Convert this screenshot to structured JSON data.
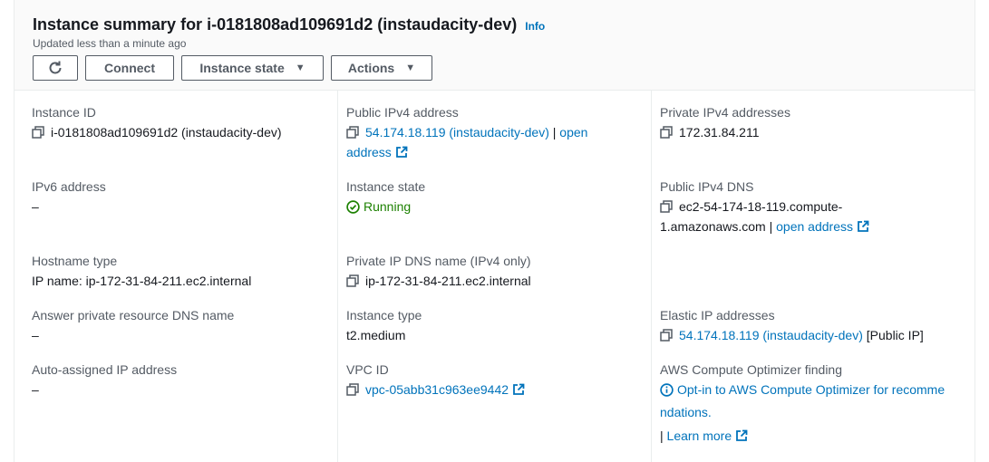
{
  "header": {
    "title": "Instance summary for i-0181808ad109691d2 (instaudacity-dev)",
    "info": "Info",
    "updated": "Updated less than a minute ago",
    "buttons": {
      "connect": "Connect",
      "instance_state": "Instance state",
      "actions": "Actions"
    }
  },
  "fields": {
    "instance_id": {
      "label": "Instance ID",
      "value": "i-0181808ad109691d2 (instaudacity-dev)"
    },
    "public_ipv4": {
      "label": "Public IPv4 address",
      "value": "54.174.18.119 (instaudacity-dev)",
      "sep": "|",
      "open1": "open",
      "open2": "address"
    },
    "private_ipv4": {
      "label": "Private IPv4 addresses",
      "value": "172.31.84.211"
    },
    "ipv6": {
      "label": "IPv6 address",
      "value": "–"
    },
    "instance_state": {
      "label": "Instance state",
      "value": "Running"
    },
    "public_dns": {
      "label": "Public IPv4 DNS",
      "line1": "ec2-54-174-18-119.compute-",
      "line2": "1.amazonaws.com",
      "sep": "|",
      "open": "open address"
    },
    "hostname_type": {
      "label": "Hostname type",
      "value": "IP name: ip-172-31-84-211.ec2.internal"
    },
    "private_dns": {
      "label": "Private IP DNS name (IPv4 only)",
      "value": "ip-172-31-84-211.ec2.internal"
    },
    "answer_dns": {
      "label": "Answer private resource DNS name",
      "value": "–"
    },
    "instance_type": {
      "label": "Instance type",
      "value": "t2.medium"
    },
    "elastic_ip": {
      "label": "Elastic IP addresses",
      "value": "54.174.18.119 (instaudacity-dev)",
      "suffix": "[Public IP]"
    },
    "auto_ip": {
      "label": "Auto-assigned IP address",
      "value": "–"
    },
    "vpc": {
      "label": "VPC ID",
      "value": "vpc-05abb31c963ee9442"
    },
    "optimizer": {
      "label": "AWS Compute Optimizer finding",
      "line1": "Opt-in to AWS Compute Optimizer for recomme",
      "line2": "ndations.",
      "sep": "|",
      "learn": "Learn more"
    }
  },
  "colors": {
    "link": "#0073bb",
    "success": "#1d8102",
    "text": "#16191f",
    "label": "#545b64"
  },
  "icons": [
    "refresh-icon",
    "caret-down-icon",
    "copy-icon",
    "external-link-icon",
    "check-circle-icon",
    "info-circle-icon"
  ]
}
